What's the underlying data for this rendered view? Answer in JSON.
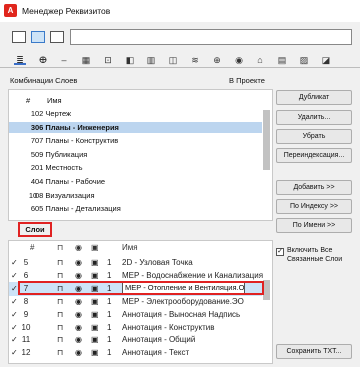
{
  "window": {
    "title": "Менеджер Реквизитов"
  },
  "search": {
    "value": ""
  },
  "combos": {
    "header": "Комбинации Слоев",
    "in_project": "В Проекте",
    "col_hash": "#",
    "col_name": "Имя",
    "rows": [
      {
        "num": "1",
        "name": "02 Чертеж",
        "selected": false
      },
      {
        "num": "3",
        "name": "06 Планы - Инженерия",
        "selected": true
      },
      {
        "num": "7",
        "name": "07 Планы - Конструктив",
        "selected": false
      },
      {
        "num": "5",
        "name": "09 Публикация",
        "selected": false
      },
      {
        "num": "2",
        "name": "01 Местность",
        "selected": false
      },
      {
        "num": "4",
        "name": "04 Планы - Рабочие",
        "selected": false
      },
      {
        "num": "10",
        "name": "08 Визуализация",
        "selected": false
      },
      {
        "num": "6",
        "name": "05 Планы - Детализация",
        "selected": false
      }
    ]
  },
  "buttons": {
    "duplicate": "Дубликат",
    "delete": "Удалить...",
    "remove": "Убрать",
    "reindex": "Переиндексация...",
    "add": "Добавить >>",
    "by_index": "По Индексу >>",
    "by_name": "По Имени >>",
    "save_txt": "Сохранить TXT..."
  },
  "layers": {
    "label": "Слои",
    "col_hash": "#",
    "col_name": "Имя",
    "include_all": "Включить Все Связанные Слои",
    "rows": [
      {
        "check": "✓",
        "num": "5",
        "idx": "1",
        "name": "2D - Узловая Точка",
        "selected": false
      },
      {
        "check": "✓",
        "num": "6",
        "idx": "1",
        "name": "MEP - Водоснабжение и Канализация",
        "selected": false
      },
      {
        "check": "✓",
        "num": "7",
        "idx": "1",
        "name": "MEP - Отопление и Вентиляция.ОВ",
        "selected": true
      },
      {
        "check": "✓",
        "num": "8",
        "idx": "1",
        "name": "MEP - Электрооборудование.ЭО",
        "selected": false
      },
      {
        "check": "✓",
        "num": "9",
        "idx": "1",
        "name": "Аннотация - Выносная Надпись",
        "selected": false
      },
      {
        "check": "✓",
        "num": "10",
        "idx": "1",
        "name": "Аннотация - Конструктив",
        "selected": false
      },
      {
        "check": "✓",
        "num": "11",
        "idx": "1",
        "name": "Аннотация - Общий",
        "selected": false
      },
      {
        "check": "✓",
        "num": "12",
        "idx": "1",
        "name": "Аннотация - Текст",
        "selected": false
      }
    ]
  }
}
